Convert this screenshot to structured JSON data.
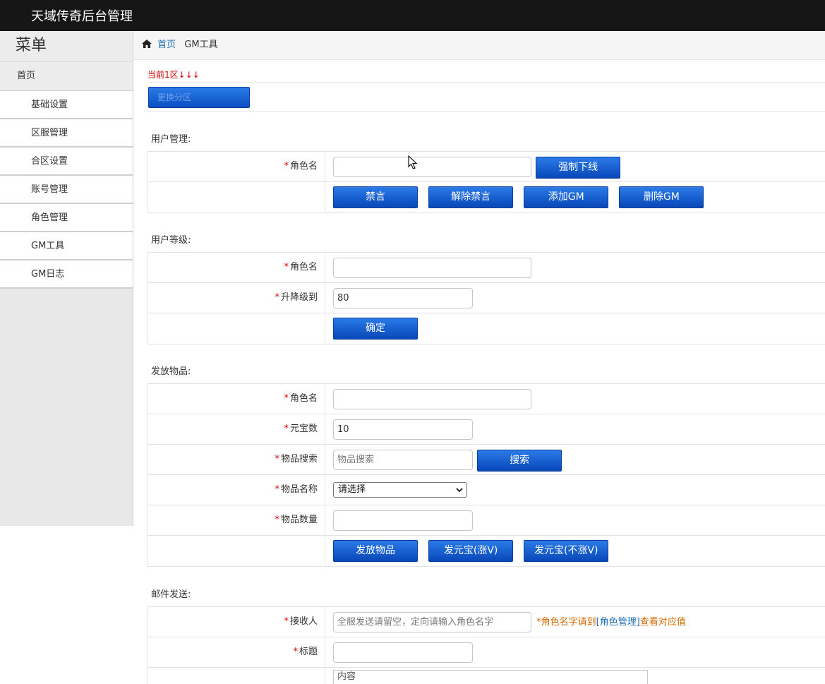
{
  "app": {
    "title": "天域传奇后台管理"
  },
  "sidebar": {
    "menu_title": "菜单",
    "home": "首页",
    "items": [
      "基础设置",
      "区服管理",
      "合区设置",
      "账号管理",
      "角色管理",
      "GM工具",
      "GM日志"
    ]
  },
  "breadcrumb": {
    "home": "首页",
    "current": "GM工具"
  },
  "zone": {
    "current_text": "当前1区↓↓↓",
    "switch_button": "更换分区"
  },
  "user_manage": {
    "title": "用户管理:",
    "role_label": "角色名",
    "role_value": "",
    "kick_button": "强制下线",
    "buttons": [
      "禁言",
      "解除禁言",
      "添加GM",
      "删除GM"
    ]
  },
  "user_level": {
    "title": "用户等级:",
    "role_label": "角色名",
    "role_value": "",
    "level_label": "升降级到",
    "level_value": "80",
    "confirm_button": "确定"
  },
  "give_items": {
    "title": "发放物品:",
    "role_label": "角色名",
    "role_value": "",
    "yuanbao_label": "元宝数",
    "yuanbao_value": "10",
    "search_label": "物品搜索",
    "search_placeholder": "物品搜索",
    "search_button": "搜索",
    "name_label": "物品名称",
    "name_selected": "请选择",
    "count_label": "物品数量",
    "count_value": "",
    "buttons": [
      "发放物品",
      "发元宝(涨V)",
      "发元宝(不涨V)"
    ]
  },
  "mail": {
    "title": "邮件发送:",
    "receiver_label": "接收人",
    "receiver_placeholder": "全服发送请留空，定向请输入角色名字",
    "hint_prefix": "*角色名字请到",
    "hint_link": "[角色管理]",
    "hint_suffix": "查看对应值",
    "subject_label": "标题",
    "subject_value": "",
    "content_placeholder": "内容"
  },
  "colors": {
    "topbar": "#161616",
    "button": "#0a55c8",
    "required": "#d40000",
    "hint": "#d46a00",
    "link": "#1f6fb5"
  }
}
